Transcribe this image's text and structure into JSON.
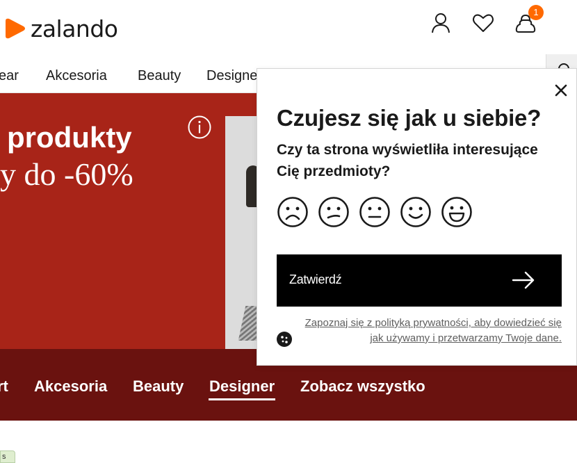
{
  "brand": {
    "name": "zalando",
    "logo_color": "#ff6900"
  },
  "header": {
    "icons": [
      "user-icon",
      "heart-icon",
      "bag-icon"
    ],
    "cart_count": "1"
  },
  "topnav": {
    "items": [
      "ear",
      "Akcesoria",
      "Beauty",
      "Designe"
    ]
  },
  "hero": {
    "title": "produkty",
    "subtitle": "y do -60%",
    "background": "#a82418",
    "info_icon": "info-icon"
  },
  "category_band": {
    "items": [
      "rt",
      "Akcesoria",
      "Beauty",
      "Designer",
      "Zobacz wszystko"
    ],
    "active": "Designer",
    "background": "#6a120f"
  },
  "corner_tab": {
    "label": "s"
  },
  "survey": {
    "title": "Czujesz się jak u siebie?",
    "question": "Czy ta strona wyświetliła interesujące Cię przedmioty?",
    "ratings": [
      "very-sad-face-icon",
      "sad-face-icon",
      "neutral-face-icon",
      "happy-face-icon",
      "very-happy-face-icon"
    ],
    "submit_label": "Zatwierdź",
    "privacy_line1": "Zapoznaj się z polityką prywatności, aby dowiedzieć się",
    "privacy_line2": "jak używamy i przetwarzamy Twoje dane.",
    "close_icon": "close-icon"
  }
}
